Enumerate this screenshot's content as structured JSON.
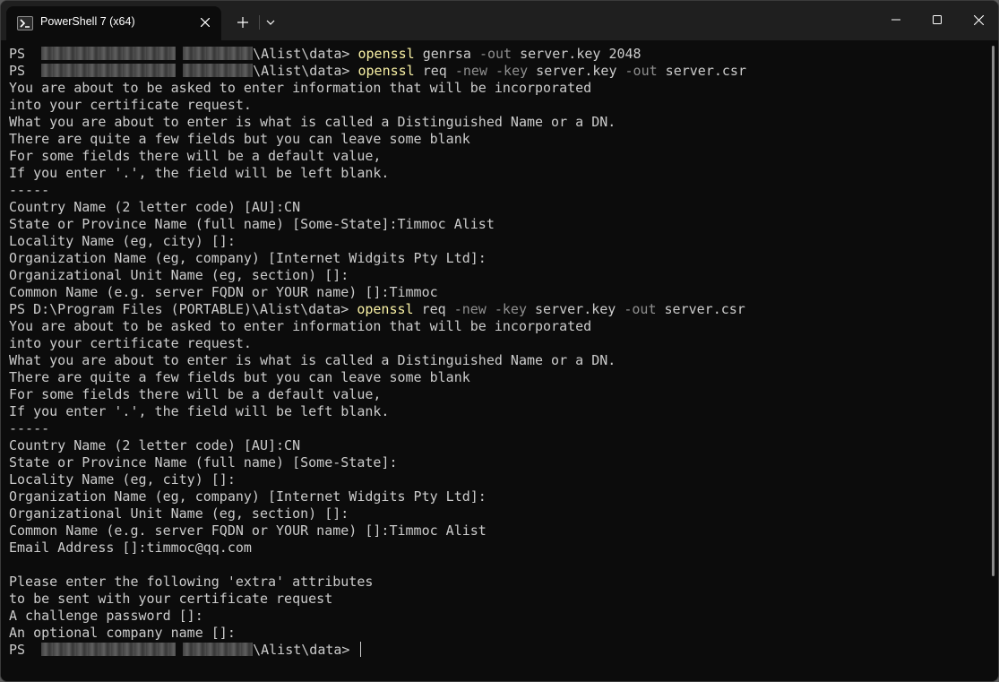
{
  "window": {
    "tab_title": "PowerShell 7 (x64)",
    "tab_icon": "powershell-icon",
    "new_tab_icon": "plus-icon",
    "dropdown_icon": "chevron-down-icon",
    "controls": [
      "minimize-icon",
      "maximize-icon",
      "close-icon"
    ]
  },
  "colors": {
    "terminal_background": "#0c0c0c",
    "text": "#cccccc",
    "command": "#f9f1a5",
    "parameter": "#8f8f8f",
    "titlebar": "#1f1f1f"
  },
  "terminal": {
    "prompt_prefix": "PS ",
    "prompt_path_suffix": "\\Alist\\data> ",
    "prompt_full": "PS D:\\Program Files (PORTABLE)\\Alist\\data> ",
    "cmd1": {
      "exe": "openssl",
      "args": [
        " genrsa ",
        "-out",
        " server.key 2048"
      ]
    },
    "cmd2": {
      "exe": "openssl",
      "args": [
        " req ",
        "-new",
        " ",
        "-key",
        " server.key ",
        "-out",
        " server.csr"
      ]
    },
    "output1": [
      "You are about to be asked to enter information that will be incorporated",
      "into your certificate request.",
      "What you are about to enter is what is called a Distinguished Name or a DN.",
      "There are quite a few fields but you can leave some blank",
      "For some fields there will be a default value,",
      "If you enter '.', the field will be left blank.",
      "-----",
      "Country Name (2 letter code) [AU]:CN",
      "State or Province Name (full name) [Some-State]:Timmoc Alist",
      "Locality Name (eg, city) []:",
      "Organization Name (eg, company) [Internet Widgits Pty Ltd]:",
      "Organizational Unit Name (eg, section) []:",
      "Common Name (e.g. server FQDN or YOUR name) []:Timmoc"
    ],
    "output2": [
      "You are about to be asked to enter information that will be incorporated",
      "into your certificate request.",
      "What you are about to enter is what is called a Distinguished Name or a DN.",
      "There are quite a few fields but you can leave some blank",
      "For some fields there will be a default value,",
      "If you enter '.', the field will be left blank.",
      "-----",
      "Country Name (2 letter code) [AU]:CN",
      "State or Province Name (full name) [Some-State]:",
      "Locality Name (eg, city) []:",
      "Organization Name (eg, company) [Internet Widgits Pty Ltd]:",
      "Organizational Unit Name (eg, section) []:",
      "Common Name (e.g. server FQDN or YOUR name) []:Timmoc Alist",
      "Email Address []:timmoc@qq.com",
      "",
      "Please enter the following 'extra' attributes",
      "to be sent with your certificate request",
      "A challenge password []:",
      "An optional company name []:"
    ]
  }
}
